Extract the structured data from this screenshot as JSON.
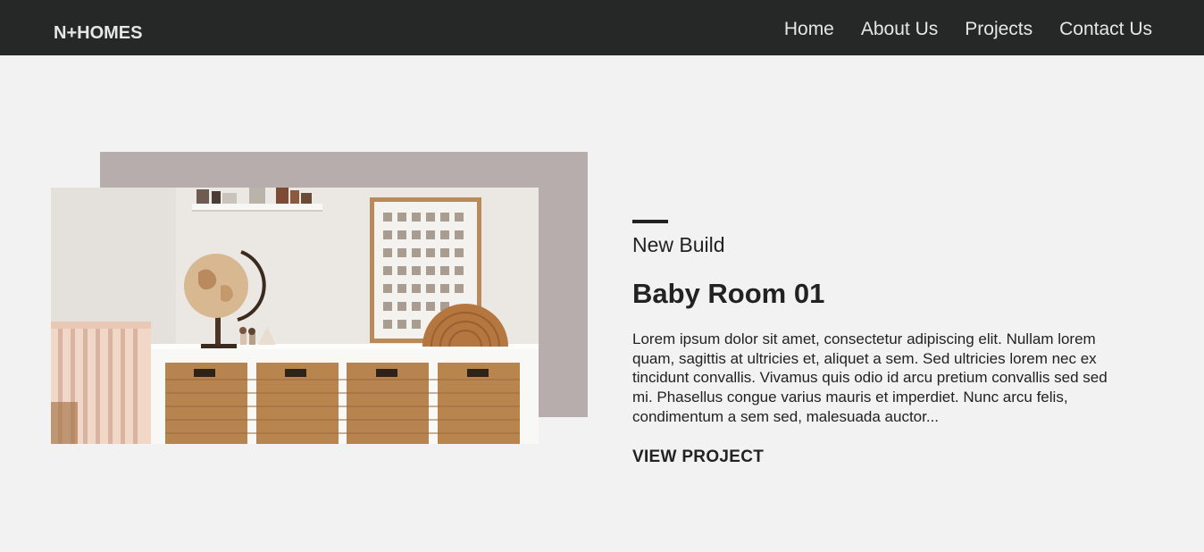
{
  "header": {
    "logo": "N+HOMES",
    "nav": [
      {
        "label": "Home"
      },
      {
        "label": "About Us"
      },
      {
        "label": "Projects"
      },
      {
        "label": "Contact Us"
      }
    ]
  },
  "project": {
    "category": "New Build",
    "title": "Baby Room 01",
    "description": "Lorem ipsum dolor sit amet, consectetur adipiscing elit. Nullam lorem quam, sagittis at ultricies et, aliquet a sem. Sed ultricies lorem nec ex tincidunt convallis. Vivamus quis odio id arcu pretium convallis sed sed mi. Phasellus congue varius mauris et imperdiet. Nunc arcu felis, condimentum a sem sed, malesuada auctor...",
    "cta": "VIEW PROJECT"
  },
  "colors": {
    "navbar": "#262827",
    "page_background": "#f2f2f2",
    "image_backdrop": "#b7adad",
    "text": "#222222"
  }
}
